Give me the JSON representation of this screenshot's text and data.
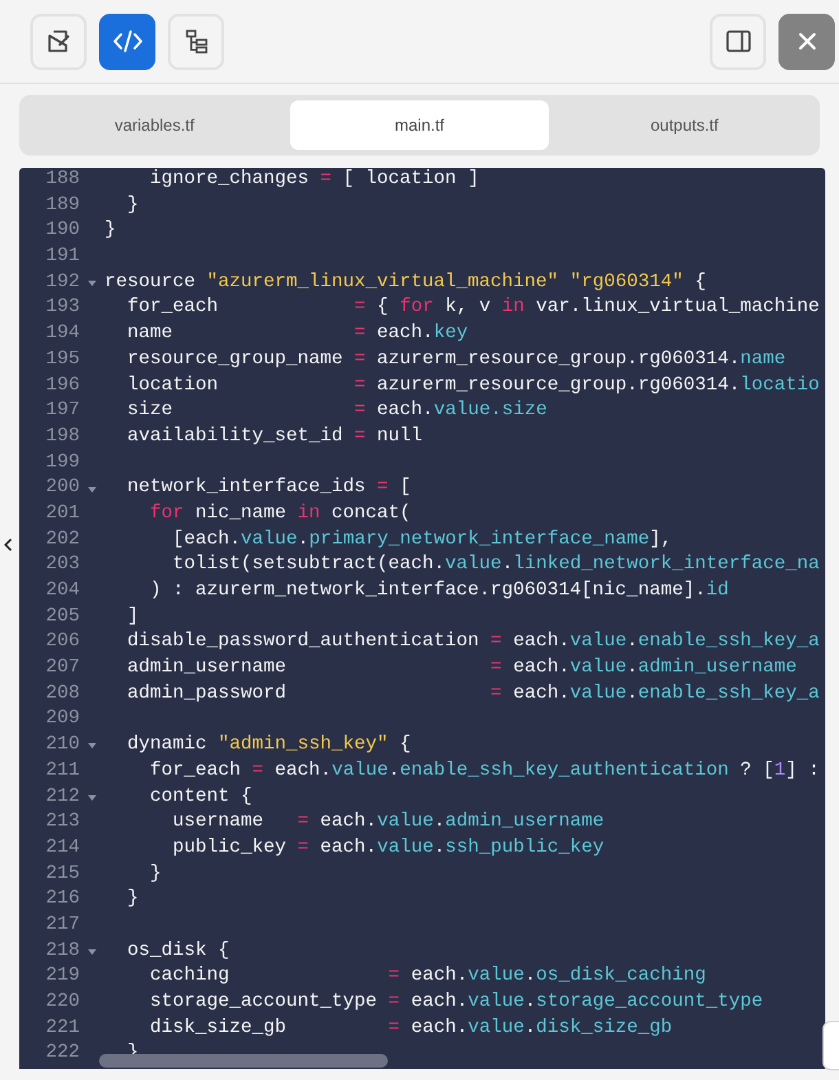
{
  "toolbar": {
    "view_buttons": [
      {
        "kind": "edit",
        "selected": false
      },
      {
        "kind": "code",
        "selected": true
      },
      {
        "kind": "tree",
        "selected": false
      }
    ]
  },
  "tabs": [
    {
      "label": "variables.tf",
      "selected": false
    },
    {
      "label": "main.tf",
      "selected": true
    },
    {
      "label": "outputs.tf",
      "selected": false
    }
  ],
  "editor": {
    "lines": [
      {
        "number": "188",
        "fold": false,
        "tokens": [
          {
            "kind": "plain",
            "text": "    ignore_changes "
          },
          {
            "kind": "op",
            "text": "="
          },
          {
            "kind": "plain",
            "text": " [ location ]"
          }
        ]
      },
      {
        "number": "189",
        "fold": false,
        "tokens": [
          {
            "kind": "plain",
            "text": "  }"
          }
        ]
      },
      {
        "number": "190",
        "fold": false,
        "tokens": [
          {
            "kind": "plain",
            "text": "}"
          }
        ]
      },
      {
        "number": "191",
        "fold": false
      },
      {
        "number": "192",
        "fold": true,
        "tokens": [
          {
            "kind": "plain",
            "text": "resource "
          },
          {
            "kind": "string",
            "text": "\"azurerm_linux_virtual_machine\""
          },
          {
            "kind": "string",
            "text": " \"rg060314\""
          },
          {
            "kind": "plain",
            "text": " {"
          }
        ]
      },
      {
        "number": "193",
        "fold": false,
        "tokens": [
          {
            "kind": "plain",
            "text": "  for_each            "
          },
          {
            "kind": "op",
            "text": "="
          },
          {
            "kind": "plain",
            "text": " { "
          },
          {
            "kind": "keyword",
            "text": "for"
          },
          {
            "kind": "plain",
            "text": " k, v "
          },
          {
            "kind": "keyword",
            "text": "in"
          },
          {
            "kind": "plain",
            "text": " var.linux_virtual_machine"
          }
        ]
      },
      {
        "number": "194",
        "fold": false,
        "tokens": [
          {
            "kind": "plain",
            "text": "  name                "
          },
          {
            "kind": "op",
            "text": "="
          },
          {
            "kind": "plain",
            "text": " each."
          },
          {
            "kind": "attr",
            "text": "key"
          }
        ]
      },
      {
        "number": "195",
        "fold": false,
        "tokens": [
          {
            "kind": "plain",
            "text": "  resource_group_name "
          },
          {
            "kind": "op",
            "text": "="
          },
          {
            "kind": "plain",
            "text": " azurerm_resource_group.rg060314."
          },
          {
            "kind": "attr",
            "text": "name"
          }
        ]
      },
      {
        "number": "196",
        "fold": false,
        "tokens": [
          {
            "kind": "plain",
            "text": "  location            "
          },
          {
            "kind": "op",
            "text": "="
          },
          {
            "kind": "plain",
            "text": " azurerm_resource_group.rg060314."
          },
          {
            "kind": "attr",
            "text": "locatio"
          }
        ]
      },
      {
        "number": "197",
        "fold": false,
        "tokens": [
          {
            "kind": "plain",
            "text": "  size                "
          },
          {
            "kind": "op",
            "text": "="
          },
          {
            "kind": "plain",
            "text": " each."
          },
          {
            "kind": "attr",
            "text": "value.size"
          }
        ]
      },
      {
        "number": "198",
        "fold": false,
        "tokens": [
          {
            "kind": "plain",
            "text": "  availability_set_id "
          },
          {
            "kind": "op",
            "text": "="
          },
          {
            "kind": "plain",
            "text": " null"
          }
        ]
      },
      {
        "number": "199",
        "fold": false
      },
      {
        "number": "200",
        "fold": true,
        "tokens": [
          {
            "kind": "plain",
            "text": "  network_interface_ids "
          },
          {
            "kind": "op",
            "text": "="
          },
          {
            "kind": "plain",
            "text": " ["
          }
        ]
      },
      {
        "number": "201",
        "fold": false,
        "tokens": [
          {
            "kind": "keyword",
            "text": "    for"
          },
          {
            "kind": "plain",
            "text": " nic_name "
          },
          {
            "kind": "keyword",
            "text": "in"
          },
          {
            "kind": "plain",
            "text": " concat("
          }
        ]
      },
      {
        "number": "202",
        "fold": false,
        "tokens": [
          {
            "kind": "plain",
            "text": "      [each."
          },
          {
            "kind": "attr",
            "text": "value"
          },
          {
            "kind": "plain",
            "text": "."
          },
          {
            "kind": "attr",
            "text": "primary_network_interface_name"
          },
          {
            "kind": "plain",
            "text": "],"
          }
        ]
      },
      {
        "number": "203",
        "fold": false,
        "tokens": [
          {
            "kind": "plain",
            "text": "      tolist(setsubtract(each."
          },
          {
            "kind": "attr",
            "text": "value"
          },
          {
            "kind": "plain",
            "text": "."
          },
          {
            "kind": "attr",
            "text": "linked_network_interface_na"
          }
        ]
      },
      {
        "number": "204",
        "fold": false,
        "tokens": [
          {
            "kind": "plain",
            "text": "    ) : azurerm_network_interface.rg060314[nic_name]."
          },
          {
            "kind": "attr",
            "text": "id"
          }
        ]
      },
      {
        "number": "205",
        "fold": false,
        "tokens": [
          {
            "kind": "plain",
            "text": "  ]"
          }
        ]
      },
      {
        "number": "206",
        "fold": false,
        "tokens": [
          {
            "kind": "plain",
            "text": "  disable_password_authentication "
          },
          {
            "kind": "op",
            "text": "="
          },
          {
            "kind": "plain",
            "text": " each."
          },
          {
            "kind": "attr",
            "text": "value"
          },
          {
            "kind": "plain",
            "text": "."
          },
          {
            "kind": "attr",
            "text": "enable_ssh_key_a"
          }
        ]
      },
      {
        "number": "207",
        "fold": false,
        "tokens": [
          {
            "kind": "plain",
            "text": "  admin_username                  "
          },
          {
            "kind": "op",
            "text": "="
          },
          {
            "kind": "plain",
            "text": " each."
          },
          {
            "kind": "attr",
            "text": "value"
          },
          {
            "kind": "plain",
            "text": "."
          },
          {
            "kind": "attr",
            "text": "admin_username"
          }
        ]
      },
      {
        "number": "208",
        "fold": false,
        "tokens": [
          {
            "kind": "plain",
            "text": "  admin_password                  "
          },
          {
            "kind": "op",
            "text": "="
          },
          {
            "kind": "plain",
            "text": " each."
          },
          {
            "kind": "attr",
            "text": "value"
          },
          {
            "kind": "plain",
            "text": "."
          },
          {
            "kind": "attr",
            "text": "enable_ssh_key_a"
          }
        ]
      },
      {
        "number": "209",
        "fold": false
      },
      {
        "number": "210",
        "fold": true,
        "tokens": [
          {
            "kind": "plain",
            "text": "  dynamic "
          },
          {
            "kind": "string",
            "text": "\"admin_ssh_key\""
          },
          {
            "kind": "plain",
            "text": " {"
          }
        ]
      },
      {
        "number": "211",
        "fold": false,
        "tokens": [
          {
            "kind": "plain",
            "text": "    for_each "
          },
          {
            "kind": "op",
            "text": "="
          },
          {
            "kind": "plain",
            "text": " each."
          },
          {
            "kind": "attr",
            "text": "value"
          },
          {
            "kind": "plain",
            "text": "."
          },
          {
            "kind": "attr",
            "text": "enable_ssh_key_authentication"
          },
          {
            "kind": "plain",
            "text": " ? ["
          },
          {
            "kind": "number",
            "text": "1"
          },
          {
            "kind": "plain",
            "text": "] :"
          }
        ]
      },
      {
        "number": "212",
        "fold": true,
        "tokens": [
          {
            "kind": "plain",
            "text": "    content {"
          }
        ]
      },
      {
        "number": "213",
        "fold": false,
        "tokens": [
          {
            "kind": "plain",
            "text": "      username   "
          },
          {
            "kind": "op",
            "text": "="
          },
          {
            "kind": "plain",
            "text": " each."
          },
          {
            "kind": "attr",
            "text": "value"
          },
          {
            "kind": "plain",
            "text": "."
          },
          {
            "kind": "attr",
            "text": "admin_username"
          }
        ]
      },
      {
        "number": "214",
        "fold": false,
        "tokens": [
          {
            "kind": "plain",
            "text": "      public_key "
          },
          {
            "kind": "op",
            "text": "="
          },
          {
            "kind": "plain",
            "text": " each."
          },
          {
            "kind": "attr",
            "text": "value"
          },
          {
            "kind": "plain",
            "text": "."
          },
          {
            "kind": "attr",
            "text": "ssh_public_key"
          }
        ]
      },
      {
        "number": "215",
        "fold": false,
        "tokens": [
          {
            "kind": "plain",
            "text": "    }"
          }
        ]
      },
      {
        "number": "216",
        "fold": false,
        "tokens": [
          {
            "kind": "plain",
            "text": "  }"
          }
        ]
      },
      {
        "number": "217",
        "fold": false
      },
      {
        "number": "218",
        "fold": true,
        "tokens": [
          {
            "kind": "plain",
            "text": "  os_disk {"
          }
        ]
      },
      {
        "number": "219",
        "fold": false,
        "tokens": [
          {
            "kind": "plain",
            "text": "    caching              "
          },
          {
            "kind": "op",
            "text": "="
          },
          {
            "kind": "plain",
            "text": " each."
          },
          {
            "kind": "attr",
            "text": "value"
          },
          {
            "kind": "plain",
            "text": "."
          },
          {
            "kind": "attr",
            "text": "os_disk_caching"
          }
        ]
      },
      {
        "number": "220",
        "fold": false,
        "tokens": [
          {
            "kind": "plain",
            "text": "    storage_account_type "
          },
          {
            "kind": "op",
            "text": "="
          },
          {
            "kind": "plain",
            "text": " each."
          },
          {
            "kind": "attr",
            "text": "value"
          },
          {
            "kind": "plain",
            "text": "."
          },
          {
            "kind": "attr",
            "text": "storage_account_type"
          }
        ]
      },
      {
        "number": "221",
        "fold": false,
        "tokens": [
          {
            "kind": "plain",
            "text": "    disk_size_gb         "
          },
          {
            "kind": "op",
            "text": "="
          },
          {
            "kind": "plain",
            "text": " each."
          },
          {
            "kind": "attr",
            "text": "value"
          },
          {
            "kind": "plain",
            "text": "."
          },
          {
            "kind": "attr",
            "text": "disk_size_gb"
          }
        ]
      },
      {
        "number": "222",
        "fold": false,
        "tokens": [
          {
            "kind": "plain",
            "text": "  }"
          }
        ]
      }
    ]
  }
}
